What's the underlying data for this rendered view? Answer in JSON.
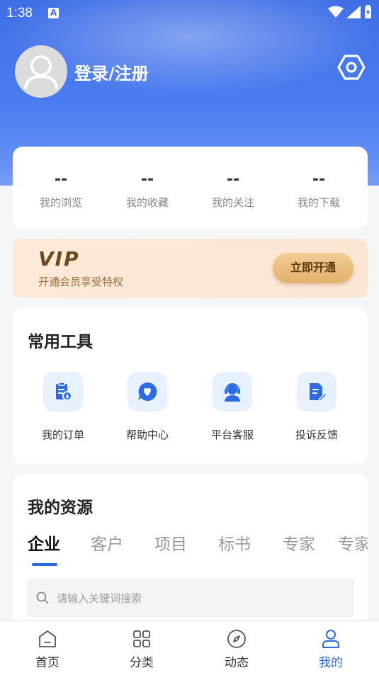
{
  "status_bar": {
    "time": "1:38",
    "notif": "A"
  },
  "profile": {
    "login_label": "登录/注册"
  },
  "stats": [
    {
      "value": "--",
      "label": "我的浏览"
    },
    {
      "value": "--",
      "label": "我的收藏"
    },
    {
      "value": "--",
      "label": "我的关注"
    },
    {
      "value": "--",
      "label": "我的下载"
    }
  ],
  "vip": {
    "logo": "VIP",
    "subtitle": "开通会员享受特权",
    "button": "立即开通"
  },
  "tools": {
    "title": "常用工具",
    "items": [
      {
        "label": "我的订单",
        "icon": "order-icon"
      },
      {
        "label": "帮助中心",
        "icon": "help-chat-icon"
      },
      {
        "label": "平台客服",
        "icon": "customer-service-icon"
      },
      {
        "label": "投诉反馈",
        "icon": "feedback-icon"
      }
    ]
  },
  "resources": {
    "title": "我的资源",
    "tabs": [
      "企业",
      "客户",
      "项目",
      "标书",
      "专家",
      "专家"
    ],
    "search_placeholder": "请输入关键词搜索"
  },
  "bottom_nav": [
    {
      "label": "首页",
      "icon": "home-icon"
    },
    {
      "label": "分类",
      "icon": "category-icon"
    },
    {
      "label": "动态",
      "icon": "compass-icon"
    },
    {
      "label": "我的",
      "icon": "user-icon"
    }
  ],
  "colors": {
    "primary": "#2f6be0",
    "hero": "#4a7bf0",
    "vip_bg": "#fce9d9",
    "vip_button": "#e4b16a"
  }
}
